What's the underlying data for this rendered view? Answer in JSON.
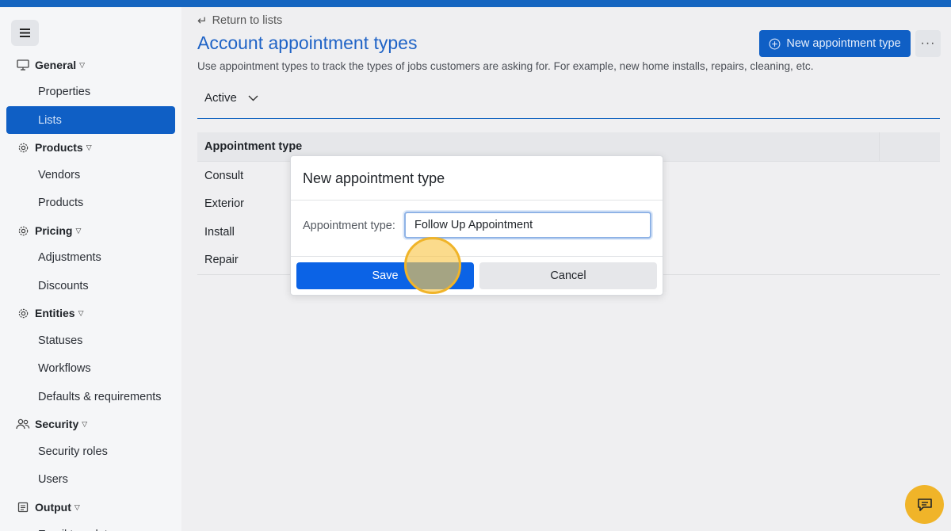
{
  "sidebar": {
    "sections": [
      {
        "label": "General",
        "items": [
          "Properties",
          "Lists"
        ]
      },
      {
        "label": "Products",
        "items": [
          "Vendors",
          "Products"
        ]
      },
      {
        "label": "Pricing",
        "items": [
          "Adjustments",
          "Discounts"
        ]
      },
      {
        "label": "Entities",
        "items": [
          "Statuses",
          "Workflows",
          "Defaults & requirements"
        ]
      },
      {
        "label": "Security",
        "items": [
          "Security roles",
          "Users"
        ]
      },
      {
        "label": "Output",
        "items": [
          "Email templates"
        ]
      }
    ],
    "active_item": "Lists"
  },
  "header": {
    "back_link": "Return to lists",
    "title": "Account appointment types",
    "description": "Use appointment types to track the types of jobs customers are asking for. For example, new home installs, repairs, cleaning, etc.",
    "new_button": "New appointment type",
    "more_button": "···"
  },
  "filter": {
    "selected": "Active"
  },
  "table": {
    "column": "Appointment type",
    "rows": [
      "Consult",
      "Exterior",
      "Install",
      "Repair"
    ]
  },
  "modal": {
    "title": "New appointment type",
    "label": "Appointment type:",
    "input_value": "Follow Up Appointment",
    "save": "Save",
    "cancel": "Cancel"
  },
  "colors": {
    "accent": "#0f5fc5",
    "primary_button": "#0b63e6",
    "click_marker": "#f0b429"
  }
}
